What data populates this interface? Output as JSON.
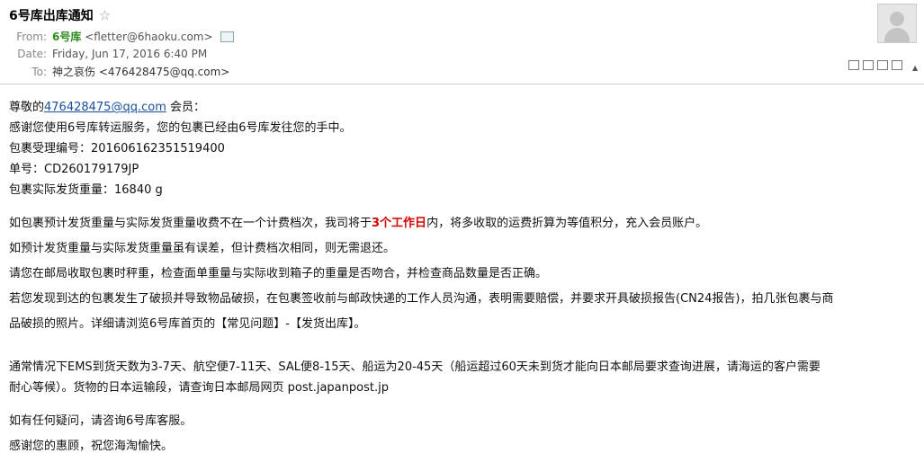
{
  "email": {
    "subject": "6号库出库通知",
    "from_label": "From:",
    "from_name": "6号库",
    "from_email": "<fletter@6haoku.com>",
    "date_label": "Date:",
    "date_value": "Friday, Jun 17, 2016 6:40 PM",
    "to_label": "To:",
    "to_value": "神之哀伤 <476428475@qq.com>"
  },
  "body": {
    "greeting_pre": "尊敬的",
    "greeting_link": "476428475@qq.com",
    "greeting_post": " 会员：",
    "line1": "感谢您使用6号库转运服务，您的包裹已经由6号库发往您的手中。",
    "line2": "包裹受理编号：201606162351519400",
    "line3": "单号：CD260179179JP",
    "line4": "包裹实际发货重量：16840 g",
    "p1_pre": "如包裹预计发货重量与实际发货重量收费不在一个计费档次，我司将于",
    "p1_red": "3个工作日",
    "p1_post": "内，将多收取的运费折算为等值积分，充入会员账户。",
    "p2": "如预计发货重量与实际发货重量虽有误差，但计费档次相同，则无需退还。",
    "p3": "请您在邮局收取包裹时秤重，检查面单重量与实际收到箱子的重量是否吻合，并检查商品数量是否正确。",
    "p4a": "若您发现到达的包裹发生了破损并导致物品破损，在包裹签收前与邮政快递的工作人员沟通，表明需要赔偿，并要求开具破损报告(CN24报告)，拍几张包裹与商",
    "p4b": "品破损的照片。详细请浏览6号库首页的【常见问题】-【发货出库】。",
    "p5a": "通常情况下EMS到货天数为3-7天、航空便7-11天、SAL便8-15天、船运为20-45天（船运超过60天未到货才能向日本邮局要求查询进展，请海运的客户需要",
    "p5b": "耐心等候）。货物的日本运输段，请查询日本邮局网页 post.japanpost.jp",
    "p6": "如有任何疑问，请咨询6号库客服。",
    "p7": "感谢您的惠顾，祝您海淘愉快。"
  }
}
